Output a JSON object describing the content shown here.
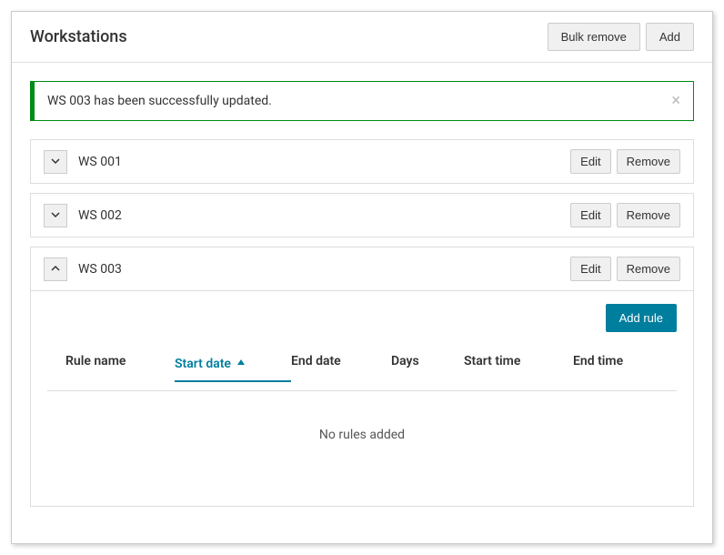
{
  "header": {
    "title": "Workstations",
    "bulk_remove_label": "Bulk remove",
    "add_label": "Add"
  },
  "alert": {
    "message": "WS 003 has been successfully updated."
  },
  "workstations": [
    {
      "name": "WS 001",
      "expanded": false,
      "edit_label": "Edit",
      "remove_label": "Remove"
    },
    {
      "name": "WS 002",
      "expanded": false,
      "edit_label": "Edit",
      "remove_label": "Remove"
    },
    {
      "name": "WS 003",
      "expanded": true,
      "edit_label": "Edit",
      "remove_label": "Remove"
    }
  ],
  "rules_panel": {
    "add_rule_label": "Add rule",
    "columns": {
      "rule_name": "Rule name",
      "start_date": "Start date",
      "end_date": "End date",
      "days": "Days",
      "start_time": "Start time",
      "end_time": "End time"
    },
    "empty_message": "No rules added"
  }
}
